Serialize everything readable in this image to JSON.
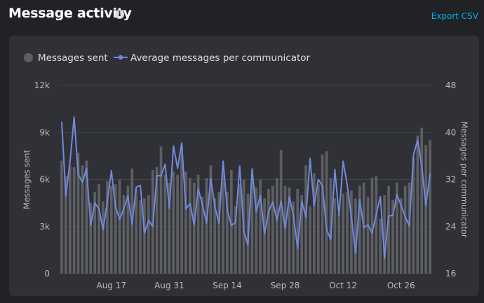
{
  "header": {
    "title": "Message activity",
    "export_label": "Export CSV"
  },
  "colors": {
    "bars": "#5d5f63",
    "line": "#7289da",
    "grid": "#40444b"
  },
  "chart_data": {
    "type": "bar+line",
    "legend": {
      "placement": "top-left",
      "items": [
        "Messages sent",
        "Average messages per communicator"
      ]
    },
    "ylabel": "Messages sent",
    "y2label": "Messages per communicator",
    "ylim": [
      0,
      12000
    ],
    "y2lim": [
      16,
      48
    ],
    "yticks": [
      {
        "value": 0,
        "label": "0"
      },
      {
        "value": 3000,
        "label": "3k"
      },
      {
        "value": 6000,
        "label": "6k"
      },
      {
        "value": 9000,
        "label": "9k"
      },
      {
        "value": 12000,
        "label": "12k"
      }
    ],
    "y2ticks": [
      {
        "value": 16,
        "label": "16"
      },
      {
        "value": 24,
        "label": "24"
      },
      {
        "value": 32,
        "label": "32"
      },
      {
        "value": 40,
        "label": "40"
      },
      {
        "value": 48,
        "label": "48"
      }
    ],
    "x_start": "2023-08-05",
    "x_end": "2023-10-30",
    "xticks": [
      {
        "date": "2023-08-17",
        "label": "Aug 17"
      },
      {
        "date": "2023-08-31",
        "label": "Aug 31"
      },
      {
        "date": "2023-09-14",
        "label": "Sep 14"
      },
      {
        "date": "2023-09-28",
        "label": "Sep 28"
      },
      {
        "date": "2023-10-12",
        "label": "Oct 12"
      },
      {
        "date": "2023-10-26",
        "label": "Oct 26"
      }
    ],
    "grid": true,
    "series": [
      {
        "name": "Messages sent",
        "type": "bar",
        "axis": "left",
        "values": [
          7200,
          6200,
          6900,
          6800,
          7700,
          6900,
          7200,
          4500,
          5200,
          5700,
          4600,
          5900,
          5600,
          5700,
          6000,
          5000,
          5600,
          6700,
          5400,
          4700,
          4800,
          5000,
          6600,
          6800,
          8100,
          6300,
          5800,
          6500,
          6300,
          8000,
          6500,
          6100,
          5800,
          6300,
          4900,
          6100,
          6900,
          4800,
          5200,
          6500,
          5200,
          6600,
          4300,
          5700,
          6000,
          5100,
          6000,
          5500,
          6000,
          4800,
          5400,
          5600,
          6100,
          7900,
          5600,
          5500,
          4600,
          5400,
          5000,
          6900,
          4300,
          6400,
          5700,
          7600,
          7800,
          6100,
          4800,
          3800,
          5100,
          5200,
          5300,
          4800,
          5600,
          5800,
          4900,
          6100,
          6200,
          3500,
          5000,
          5600,
          4700,
          5800,
          4800,
          5600,
          5800,
          7400,
          8800,
          9300,
          8200,
          8500
        ]
      },
      {
        "name": "Average messages per communicator",
        "type": "line",
        "axis": "right",
        "values": [
          41.8,
          29.2,
          35.0,
          42.6,
          32.9,
          31.5,
          33.9,
          24.2,
          28.0,
          27.0,
          23.5,
          28.1,
          33.5,
          27.3,
          25.2,
          27.0,
          29.2,
          24.4,
          30.7,
          31.0,
          22.9,
          25.0,
          24.0,
          32.7,
          32.6,
          34.6,
          27.1,
          37.7,
          33.9,
          38.2,
          27.0,
          27.9,
          24.3,
          30.4,
          27.7,
          24.6,
          32.2,
          27.4,
          24.6,
          35.1,
          26.8,
          24.2,
          24.7,
          34.3,
          23.2,
          20.9,
          33.8,
          26.5,
          29.3,
          22.8,
          26.5,
          28.2,
          25.1,
          28.3,
          23.7,
          29.1,
          25.8,
          20.3,
          28.3,
          25.6,
          35.6,
          27.6,
          32.0,
          30.9,
          23.5,
          21.8,
          33.7,
          25.9,
          35.1,
          31.0,
          25.6,
          19.5,
          28.6,
          23.8,
          24.3,
          22.9,
          26.1,
          29.1,
          18.6,
          25.8,
          25.9,
          29.4,
          27.6,
          25.7,
          24.1,
          36.2,
          38.7,
          34.2,
          27.6,
          33.0
        ]
      }
    ]
  }
}
